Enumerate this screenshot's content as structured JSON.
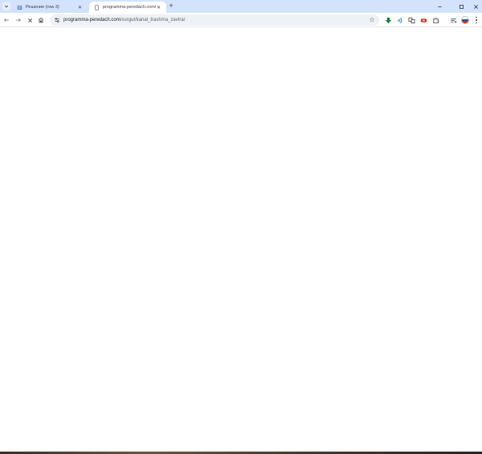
{
  "tabs": [
    {
      "title": "Решение (row 3)",
      "active": false
    },
    {
      "title": "programma-peredach.com/su...",
      "active": true
    }
  ],
  "omnibox": {
    "host": "programma-peredach.com",
    "path": "/surgut/kanal_trash/na_zavtra/"
  },
  "icons": {
    "tab_search": "chevron-down-icon",
    "back": "back-arrow-icon",
    "forward": "forward-arrow-icon",
    "stop": "stop-loading-icon",
    "home": "home-icon",
    "site_info": "tune-icon",
    "bookmark": "star-icon",
    "extensions": [
      "download-arrow-icon",
      "wifi-icon",
      "translate-icon",
      "record-icon",
      "puzzle-icon",
      "cast-icon"
    ],
    "profile": "avatar-flag",
    "menu": "kebab-menu-icon"
  },
  "colors": {
    "tabstrip": "#d3e3fd",
    "omnibox": "#eef1f6",
    "download_arrow": "#188038",
    "wifi": "#1a73e8",
    "record": "#d93025"
  }
}
